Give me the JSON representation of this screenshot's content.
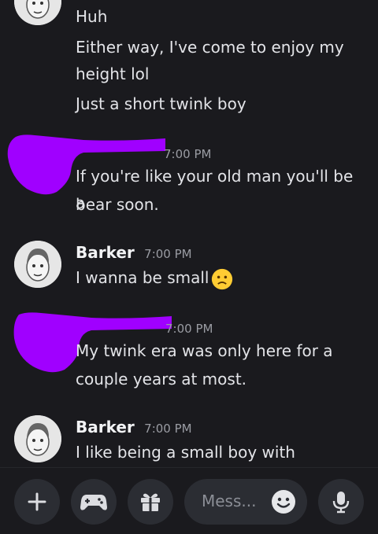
{
  "messages": [
    {
      "text": "Huh"
    },
    {
      "text": "Either way, I've come to enjoy my"
    },
    {
      "text": "height lol"
    },
    {
      "text": "Just a short twink boy"
    },
    {
      "time": "7:00 PM"
    },
    {
      "text": "If you're like your old man you'll be a"
    },
    {
      "text": "bear soon."
    },
    {
      "author": "Barker",
      "time": "7:00 PM"
    },
    {
      "text": "I wanna be small"
    },
    {
      "time": "7:00 PM"
    },
    {
      "text": "My twink era was only here for a"
    },
    {
      "text": "couple years at most."
    },
    {
      "author": "Barker",
      "time": "7:00 PM"
    },
    {
      "text": "I like being a small boy with"
    }
  ],
  "composer": {
    "placeholder": "Mess...",
    "icons": [
      "plus-icon",
      "gamepad-icon",
      "gift-icon",
      "emoji-icon",
      "microphone-icon"
    ]
  },
  "colors": {
    "background": "#1a1a1e",
    "scribble": "#a000ff",
    "button": "#2b2d33"
  }
}
